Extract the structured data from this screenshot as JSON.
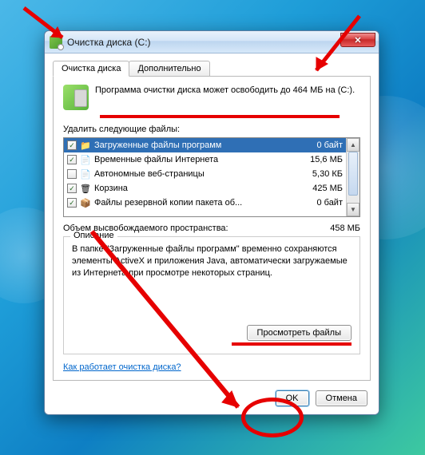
{
  "window": {
    "title": "Очистка диска  (C:)"
  },
  "tabs": {
    "active": "Очистка диска",
    "second": "Дополнительно"
  },
  "intro": "Программа очистки диска может освободить до 464 МБ на  (C:).",
  "list_label": "Удалить следующие файлы:",
  "files": [
    {
      "checked": true,
      "icon": "📁",
      "name": "Загруженные файлы программ",
      "size": "0 байт",
      "selected": true
    },
    {
      "checked": true,
      "icon": "📄",
      "name": "Временные файлы Интернета",
      "size": "15,6 МБ",
      "selected": false
    },
    {
      "checked": false,
      "icon": "📄",
      "name": "Автономные веб-страницы",
      "size": "5,30 КБ",
      "selected": false
    },
    {
      "checked": true,
      "icon": "🗑",
      "name": "Корзина",
      "size": "425 МБ",
      "selected": false
    },
    {
      "checked": true,
      "icon": "📦",
      "name": "Файлы резервной копии пакета об...",
      "size": "0 байт",
      "selected": false
    }
  ],
  "total": {
    "label": "Объем высвобождаемого пространства:",
    "value": "458 МБ"
  },
  "description": {
    "legend": "Описание",
    "text": "В папке \"Загруженные файлы программ\" временно сохраняются элементы ActiveX и приложения Java, автоматически загружаемые из Интернета при просмотре некоторых страниц."
  },
  "buttons": {
    "view_files": "Просмотреть файлы",
    "ok": "OK",
    "cancel": "Отмена"
  },
  "link": "Как работает очистка диска?"
}
